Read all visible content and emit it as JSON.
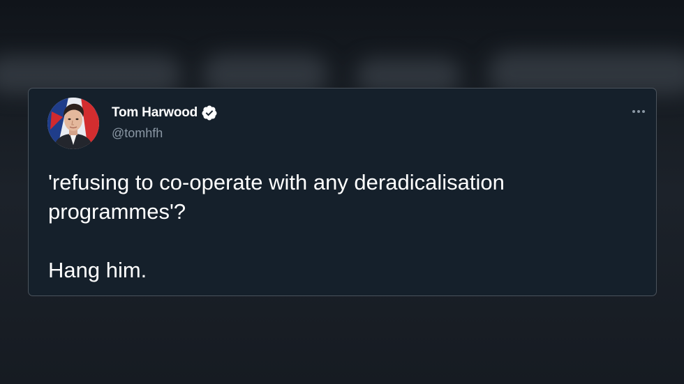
{
  "tweet": {
    "author_name": "Tom Harwood",
    "handle": "@tomhfh",
    "verified": true,
    "verified_icon": "verified-badge-icon",
    "more_icon": "more-options-icon",
    "text_lines": [
      "'refusing to co-operate with any deradicalisation",
      "programmes'?",
      "Hang him."
    ]
  },
  "colors": {
    "card_bg": "#15202b",
    "card_border": "#4b535c",
    "text": "#ffffff",
    "secondary_text": "#8b98a5"
  }
}
